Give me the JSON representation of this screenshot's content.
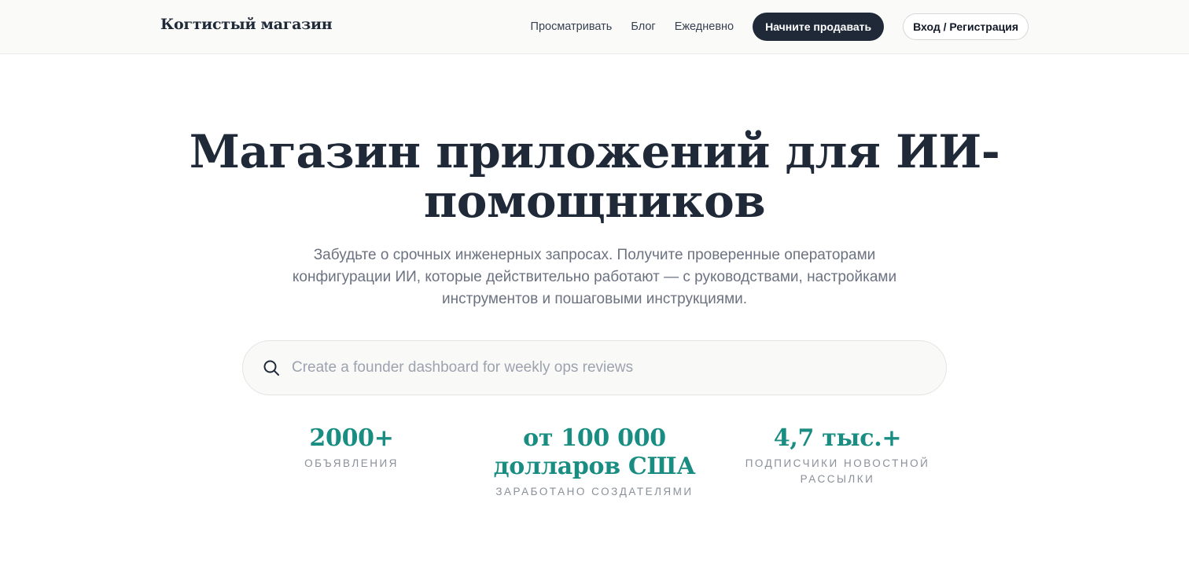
{
  "header": {
    "brand": "Когтистый магазин",
    "nav": [
      {
        "label": "Просматривать"
      },
      {
        "label": "Блог"
      },
      {
        "label": "Ежедневно"
      }
    ],
    "sell_label": "Начните продавать",
    "login_label": "Вход / Регистрация"
  },
  "hero": {
    "title": "Магазин приложений для ИИ-помощников",
    "subtitle": "Забудьте о срочных инженерных запросах. Получите проверенные операторами конфигурации ИИ, которые действительно работают — с руководствами, настройками инструментов и пошаговыми инструкциями."
  },
  "search": {
    "placeholder": "Create a founder dashboard for weekly ops reviews",
    "value": "",
    "icon": "search-icon"
  },
  "stats": [
    {
      "value": "2000+",
      "label": "ОБЪЯВЛЕНИЯ"
    },
    {
      "value": "от 100 000 долларов США",
      "label": "ЗАРАБОТАНО СОЗДАТЕЛЯМИ"
    },
    {
      "value": "4,7 тыс.+",
      "label": "ПОДПИСЧИКИ НОВОСТНОЙ РАССЫЛКИ"
    }
  ],
  "colors": {
    "primary": "#1f2937",
    "accent": "#1a8d82",
    "muted": "#6b7280"
  }
}
